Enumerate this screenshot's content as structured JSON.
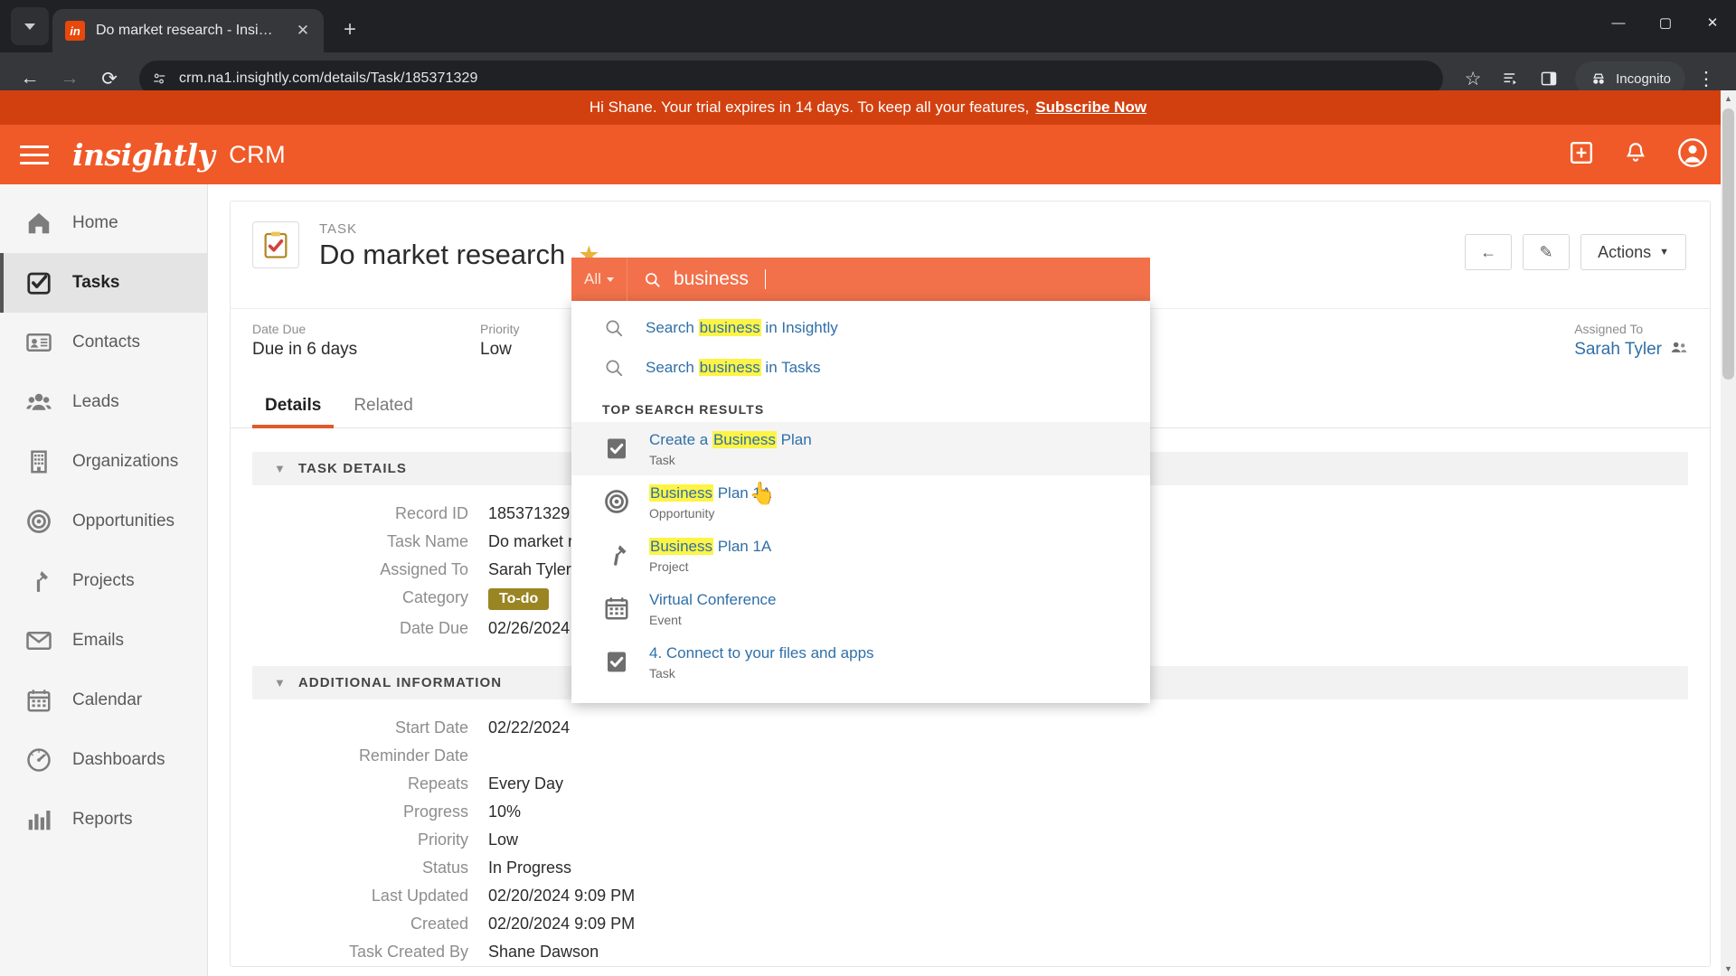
{
  "browser": {
    "tab": {
      "title": "Do market research - Insightly",
      "favicon_text": "in"
    },
    "new_tab_label": "+",
    "close_label": "✕",
    "url": "crm.na1.insightly.com/details/Task/185371329",
    "incognito_label": "Incognito",
    "window": {
      "minimize": "—",
      "maximize": "▢",
      "close": "✕"
    }
  },
  "trial": {
    "message": "Hi Shane. Your trial expires in 14 days. To keep all your features,",
    "cta": "Subscribe Now"
  },
  "appbar": {
    "logo": "insightly",
    "product": "CRM",
    "search_scope": "All",
    "search_value": "business",
    "add_icon": "plus-icon",
    "bell_icon": "bell-icon",
    "account_icon": "account-icon"
  },
  "search_dropdown": {
    "quick": [
      {
        "prefix": "Search ",
        "match": "business",
        "suffix": " in Insightly"
      },
      {
        "prefix": "Search ",
        "match": "business",
        "suffix": " in Tasks"
      }
    ],
    "section_label": "TOP SEARCH RESULTS",
    "results": [
      {
        "prefix": "Create a ",
        "match": "Business",
        "suffix": " Plan",
        "type": "Task",
        "icon": "task-clipboard-icon",
        "highlighted": true
      },
      {
        "prefix": "",
        "match": "Business",
        "suffix": " Plan 1A",
        "type": "Opportunity",
        "icon": "target-icon",
        "highlighted": false
      },
      {
        "prefix": "",
        "match": "Business",
        "suffix": " Plan 1A",
        "type": "Project",
        "icon": "hammer-icon",
        "highlighted": false
      },
      {
        "prefix": "Virtual Conference",
        "match": "",
        "suffix": "",
        "type": "Event",
        "icon": "calendar-icon",
        "highlighted": false
      },
      {
        "prefix": "4. Connect to your files and apps",
        "match": "",
        "suffix": "",
        "type": "Task",
        "icon": "task-clipboard-icon",
        "highlighted": false
      }
    ]
  },
  "sidebar": {
    "items": [
      {
        "label": "Home",
        "icon": "home-icon",
        "active": false
      },
      {
        "label": "Tasks",
        "icon": "tasks-icon",
        "active": true
      },
      {
        "label": "Contacts",
        "icon": "contacts-icon",
        "active": false
      },
      {
        "label": "Leads",
        "icon": "leads-icon",
        "active": false
      },
      {
        "label": "Organizations",
        "icon": "organizations-icon",
        "active": false
      },
      {
        "label": "Opportunities",
        "icon": "opportunities-icon",
        "active": false
      },
      {
        "label": "Projects",
        "icon": "projects-icon",
        "active": false
      },
      {
        "label": "Emails",
        "icon": "emails-icon",
        "active": false
      },
      {
        "label": "Calendar",
        "icon": "calendar-icon",
        "active": false
      },
      {
        "label": "Dashboards",
        "icon": "dashboards-icon",
        "active": false
      },
      {
        "label": "Reports",
        "icon": "reports-icon",
        "active": false
      }
    ]
  },
  "record": {
    "kind": "TASK",
    "title": "Do market research",
    "star_icon": "star-icon",
    "back_icon": "back-arrow-icon",
    "edit_icon": "pencil-icon",
    "actions_label": "Actions",
    "summary": {
      "due_label": "Date Due",
      "due_value": "Due in 6 days",
      "priority_label": "Priority",
      "priority_value": "Low",
      "assigned_label": "Assigned To",
      "assigned_value": "Sarah Tyler"
    },
    "tabs": [
      {
        "label": "Details",
        "active": true
      },
      {
        "label": "Related",
        "active": false
      }
    ],
    "sections": [
      {
        "title": "TASK DETAILS",
        "fields": [
          {
            "label": "Record ID",
            "value": "185371329",
            "type": "text"
          },
          {
            "label": "Task Name",
            "value": "Do market research",
            "type": "text"
          },
          {
            "label": "Assigned To",
            "value": "Sarah Tyler",
            "type": "text"
          },
          {
            "label": "Category",
            "value": "To-do",
            "type": "badge"
          },
          {
            "label": "Date Due",
            "value": "02/26/2024",
            "type": "text"
          }
        ]
      },
      {
        "title": "ADDITIONAL INFORMATION",
        "fields": [
          {
            "label": "Start Date",
            "value": "02/22/2024",
            "type": "text"
          },
          {
            "label": "Reminder Date",
            "value": "",
            "type": "text"
          },
          {
            "label": "Repeats",
            "value": "Every Day",
            "type": "text"
          },
          {
            "label": "Progress",
            "value": "10%",
            "type": "text"
          },
          {
            "label": "Priority",
            "value": "Low",
            "type": "text"
          },
          {
            "label": "Status",
            "value": "In Progress",
            "type": "text"
          },
          {
            "label": "Last Updated",
            "value": "02/20/2024 9:09 PM",
            "type": "text"
          },
          {
            "label": "Created",
            "value": "02/20/2024 9:09 PM",
            "type": "text"
          },
          {
            "label": "Task Created By",
            "value": "Shane Dawson",
            "type": "text"
          }
        ]
      }
    ]
  },
  "colors": {
    "brand_orange": "#F05A28",
    "trial_bar": "#D3400F",
    "link_blue": "#2f6fa8",
    "highlight_yellow": "#FDF445",
    "badge_gold": "#9A8523"
  }
}
